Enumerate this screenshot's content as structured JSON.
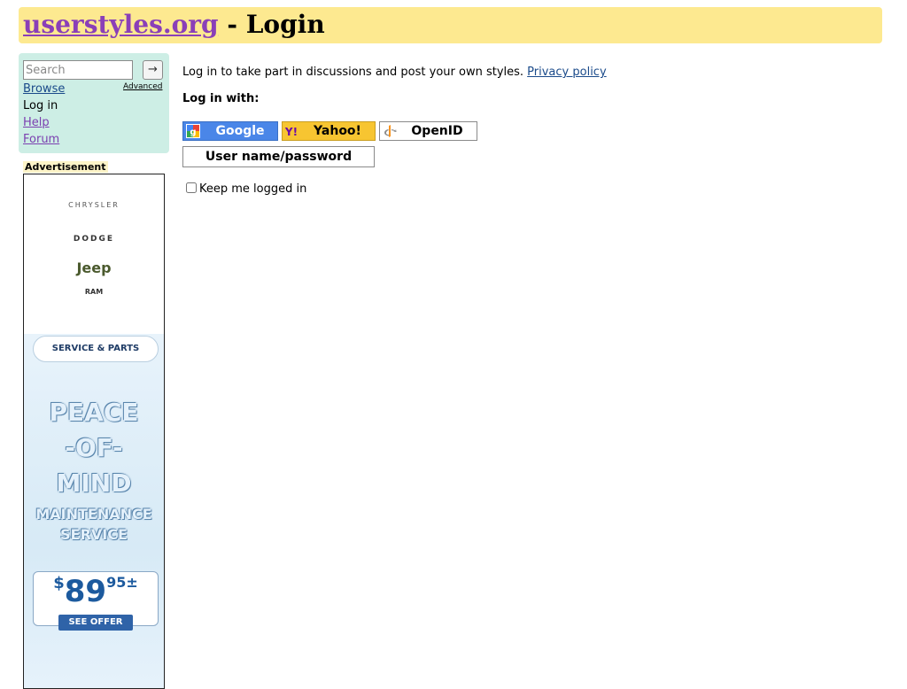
{
  "header": {
    "site_link": "userstyles.org",
    "title_suffix": " - Login"
  },
  "sidebar": {
    "search_placeholder": "Search",
    "search_button": "→",
    "advanced_link": "Advanced",
    "items": [
      {
        "label": "Browse"
      },
      {
        "label": "Log in"
      },
      {
        "label": "Help"
      },
      {
        "label": "Forum"
      }
    ]
  },
  "ad": {
    "label": "Advertisement",
    "brands": [
      "CHRYSLER",
      "DODGE",
      "Jeep",
      "RAM"
    ],
    "service_parts": "SERVICE & PARTS",
    "headline": [
      "PEACE",
      "-OF-",
      "MIND",
      "MAINTENANCE",
      "SERVICE"
    ],
    "price_dollar": "$",
    "price_main": "89",
    "price_cents": "95±",
    "cta": "SEE OFFER"
  },
  "main": {
    "intro_text": "Log in to take part in discussions and post your own styles. ",
    "privacy_link": "Privacy policy",
    "login_with": "Log in with:",
    "buttons": {
      "google": "Google",
      "yahoo": "Yahoo!",
      "openid": "OpenID",
      "userpass": "User name/password"
    },
    "keep_logged_in": "Keep me logged in",
    "keep_logged_in_checked": false
  },
  "colors": {
    "header_bg": "#fde990",
    "sidebar_bg": "#cdeee5",
    "google_blue": "#4a86e8",
    "yahoo_yellow": "#f7c531",
    "visited_link": "#7b3fb0",
    "link": "#1a4a8a"
  }
}
